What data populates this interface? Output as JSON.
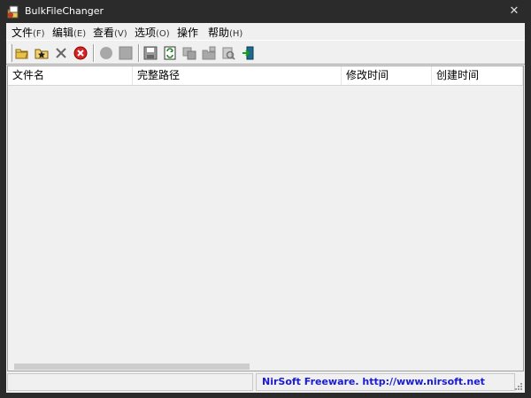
{
  "window": {
    "title": "BulkFileChanger",
    "close_glyph": "✕"
  },
  "menubar": {
    "items": [
      {
        "label": "文件",
        "accel": "(F)"
      },
      {
        "label": "编辑",
        "accel": "(E)"
      },
      {
        "label": "查看",
        "accel": "(V)"
      },
      {
        "label": "选项",
        "accel": "(O)"
      },
      {
        "label": "操作",
        "accel": ""
      },
      {
        "label": "帮助",
        "accel": "(H)"
      }
    ]
  },
  "toolbar": {
    "icons": [
      "open-folder-icon",
      "add-folder-icon",
      "delete-icon",
      "stop-icon",
      "circle-icon",
      "square-icon",
      "save-icon",
      "refresh-icon",
      "copy-icon",
      "folder-small-icon",
      "properties-icon",
      "exit-icon"
    ]
  },
  "listview": {
    "columns": [
      "文件名",
      "完整路径",
      "修改时间",
      "创建时间"
    ]
  },
  "statusbar": {
    "left": "",
    "right": "NirSoft Freeware.  http://www.nirsoft.net"
  },
  "colors": {
    "link": "#1a1ad6",
    "titlebar": "#2b2b2b",
    "client": "#f0f0f0"
  }
}
